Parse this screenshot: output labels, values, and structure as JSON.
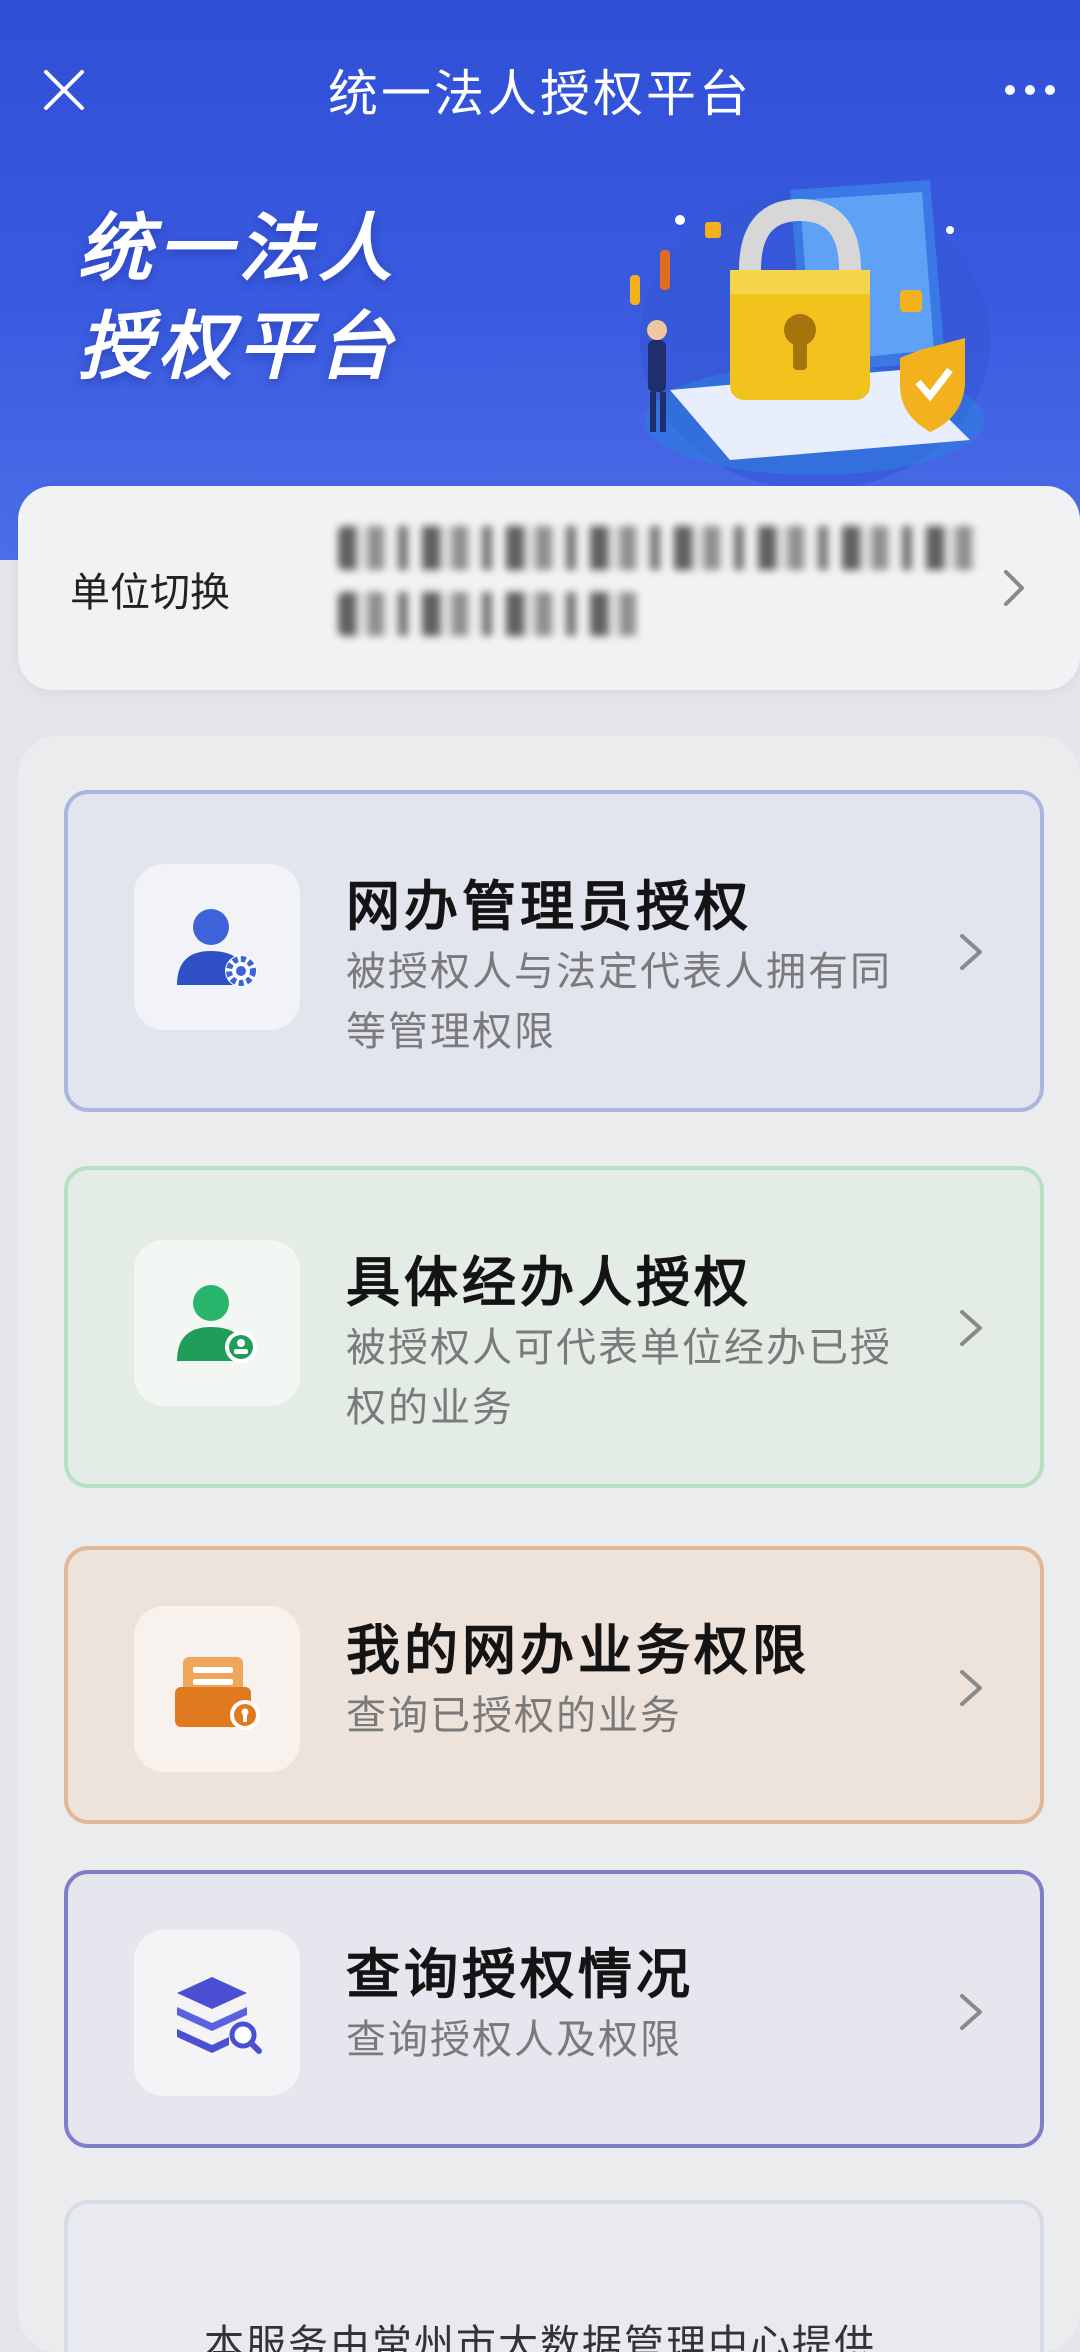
{
  "navbar": {
    "title": "统一法人授权平台",
    "close_icon": "close-icon",
    "more_icon": "more-icon"
  },
  "hero": {
    "title_line1": "统一法人",
    "title_line2": "授权平台",
    "illustration": "padlock-laptop-illustration"
  },
  "org_switch": {
    "label": "单位切换",
    "value_redacted": true
  },
  "menu": [
    {
      "title": "网办管理员授权",
      "desc": "被授权人与法定代表人拥有同等管理权限",
      "icon": "user-gear-icon",
      "accent": "#3d63d8",
      "border": "#aab6dd",
      "bg": "#e2e5ee"
    },
    {
      "title": "具体经办人授权",
      "desc": "被授权人可代表单位经办已授权的业务",
      "icon": "user-badge-icon",
      "accent": "#28b56b",
      "border": "#b9dfc3",
      "bg": "#e3ede6"
    },
    {
      "title": "我的网办业务权限",
      "desc": "查询已授权的业务",
      "icon": "folder-lock-icon",
      "accent": "#e07a1f",
      "border": "#e0b899",
      "bg": "#ede3da"
    },
    {
      "title": "查询授权情况",
      "desc": "查询授权人及权限",
      "icon": "layers-search-icon",
      "accent": "#4b4fd3",
      "border": "#7d80c9",
      "bg": "#e6e6ee"
    }
  ],
  "footer": {
    "text": "本服务由常州市大数据管理中心提供"
  }
}
